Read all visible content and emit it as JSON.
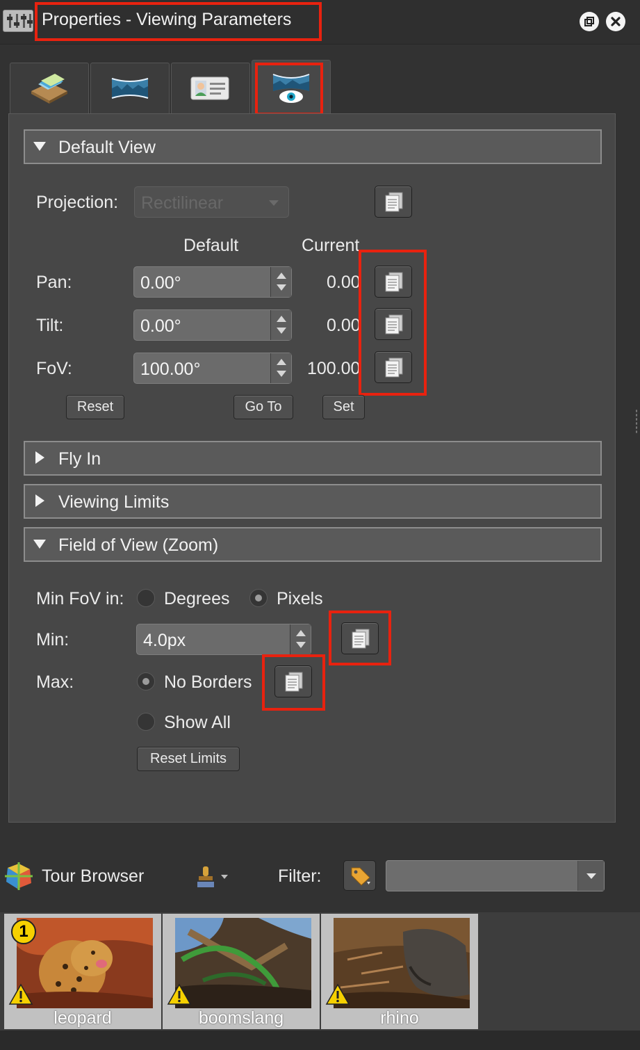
{
  "window": {
    "title": "Properties - Viewing Parameters",
    "restore_icon": "restore-window-icon",
    "close_icon": "close-icon"
  },
  "tabs": [
    {
      "icon": "tour-layers-icon"
    },
    {
      "icon": "panorama-icon"
    },
    {
      "icon": "user-info-card-icon"
    },
    {
      "icon": "viewing-parameters-eye-icon",
      "active": true
    }
  ],
  "default_view": {
    "header": "Default View",
    "projection_label": "Projection:",
    "projection_value": "Rectilinear",
    "col_default": "Default",
    "col_current": "Current",
    "rows": [
      {
        "label": "Pan:",
        "default": "0.00°",
        "current": "0.00"
      },
      {
        "label": "Tilt:",
        "default": "0.00°",
        "current": "0.00"
      },
      {
        "label": "FoV:",
        "default": "100.00°",
        "current": "100.00"
      }
    ],
    "reset_label": "Reset",
    "goto_label": "Go To",
    "set_label": "Set"
  },
  "sections": {
    "fly_in": "Fly In",
    "viewing_limits": "Viewing Limits",
    "field_of_view": "Field of View (Zoom)"
  },
  "fov": {
    "min_fov_in_label": "Min FoV in:",
    "degrees_label": "Degrees",
    "pixels_label": "Pixels",
    "selected_unit": "Pixels",
    "min_label": "Min:",
    "min_value": "4.0px",
    "max_label": "Max:",
    "no_borders_label": "No Borders",
    "show_all_label": "Show All",
    "selected_max": "No Borders",
    "reset_limits_label": "Reset Limits"
  },
  "tour_browser": {
    "title": "Tour Browser",
    "filter_label": "Filter:",
    "filter_value": "",
    "items": [
      {
        "name": "leopard",
        "badge": "1",
        "warning": true
      },
      {
        "name": "boomslang",
        "warning": true
      },
      {
        "name": "rhino",
        "warning": true
      }
    ]
  },
  "colors": {
    "highlight": "#e8220f",
    "panel": "#474747",
    "section_header": "#5a5a5a"
  }
}
